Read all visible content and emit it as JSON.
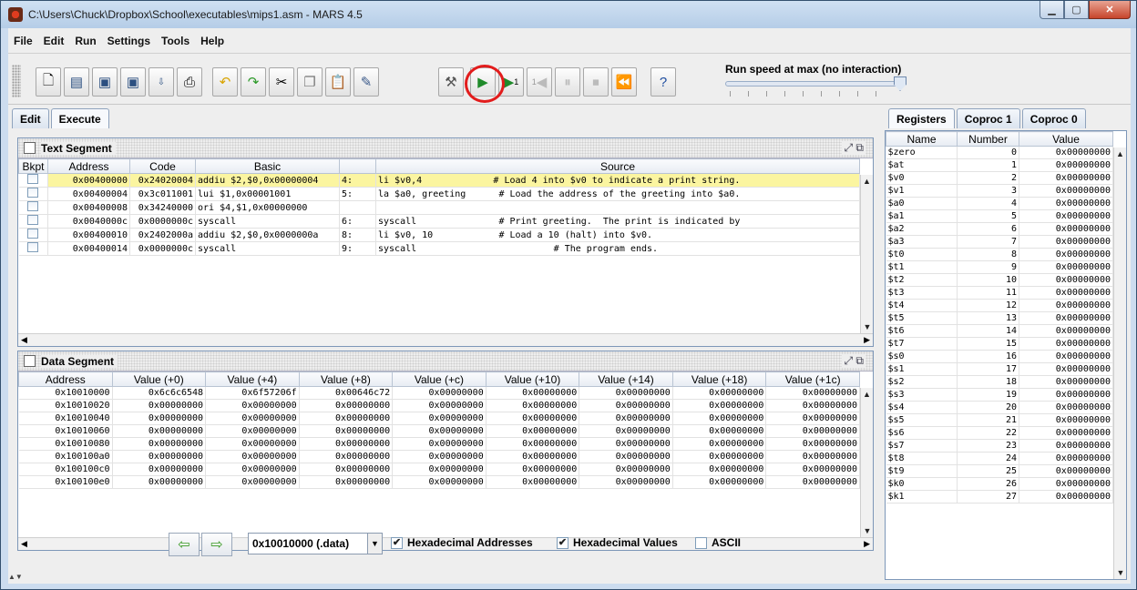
{
  "window": {
    "title": "C:\\Users\\Chuck\\Dropbox\\School\\executables\\mips1.asm  - MARS 4.5"
  },
  "menu": [
    "File",
    "Edit",
    "Run",
    "Settings",
    "Tools",
    "Help"
  ],
  "toolbar": {
    "buttons": [
      "new-icon",
      "open-icon",
      "save-icon",
      "save-as-icon",
      "dump-memory-icon",
      "print-icon",
      "undo-icon",
      "redo-icon",
      "cut-icon",
      "copy-icon",
      "paste-icon",
      "find-replace-icon",
      "assemble-icon",
      "run-icon",
      "step-icon",
      "backstep-icon",
      "pause-icon",
      "stop-icon",
      "reset-icon",
      "help-icon"
    ],
    "step_label": "1",
    "backstep_label": "1",
    "speed_label": "Run speed at max (no interaction)",
    "speed_level": 1.0
  },
  "tabs": {
    "edit": "Edit",
    "execute": "Execute"
  },
  "text_segment": {
    "title": "Text Segment",
    "columns": [
      "Bkpt",
      "Address",
      "Code",
      "Basic",
      "",
      "Source"
    ],
    "rows": [
      {
        "addr": "0x00400000",
        "code": "0x24020004",
        "basic": "addiu $2,$0,0x00000004",
        "line": "4:",
        "source": "li $v0,4             # Load 4 into $v0 to indicate a print string."
      },
      {
        "addr": "0x00400004",
        "code": "0x3c011001",
        "basic": "lui $1,0x00001001",
        "line": "5:",
        "source": "la $a0, greeting      # Load the address of the greeting into $a0."
      },
      {
        "addr": "0x00400008",
        "code": "0x34240000",
        "basic": "ori $4,$1,0x00000000",
        "line": "",
        "source": ""
      },
      {
        "addr": "0x0040000c",
        "code": "0x0000000c",
        "basic": "syscall",
        "line": "6:",
        "source": "syscall               # Print greeting.  The print is indicated by"
      },
      {
        "addr": "0x00400010",
        "code": "0x2402000a",
        "basic": "addiu $2,$0,0x0000000a",
        "line": "8:",
        "source": "li $v0, 10            # Load a 10 (halt) into $v0."
      },
      {
        "addr": "0x00400014",
        "code": "0x0000000c",
        "basic": "syscall",
        "line": "9:",
        "source": "syscall                         # The program ends."
      }
    ]
  },
  "data_segment": {
    "title": "Data Segment",
    "columns": [
      "Address",
      "Value (+0)",
      "Value (+4)",
      "Value (+8)",
      "Value (+c)",
      "Value (+10)",
      "Value (+14)",
      "Value (+18)",
      "Value (+1c)"
    ],
    "rows": [
      [
        "0x10010000",
        "0x6c6c6548",
        "0x6f57206f",
        "0x00646c72",
        "0x00000000",
        "0x00000000",
        "0x00000000",
        "0x00000000",
        "0x00000000"
      ],
      [
        "0x10010020",
        "0x00000000",
        "0x00000000",
        "0x00000000",
        "0x00000000",
        "0x00000000",
        "0x00000000",
        "0x00000000",
        "0x00000000"
      ],
      [
        "0x10010040",
        "0x00000000",
        "0x00000000",
        "0x00000000",
        "0x00000000",
        "0x00000000",
        "0x00000000",
        "0x00000000",
        "0x00000000"
      ],
      [
        "0x10010060",
        "0x00000000",
        "0x00000000",
        "0x00000000",
        "0x00000000",
        "0x00000000",
        "0x00000000",
        "0x00000000",
        "0x00000000"
      ],
      [
        "0x10010080",
        "0x00000000",
        "0x00000000",
        "0x00000000",
        "0x00000000",
        "0x00000000",
        "0x00000000",
        "0x00000000",
        "0x00000000"
      ],
      [
        "0x100100a0",
        "0x00000000",
        "0x00000000",
        "0x00000000",
        "0x00000000",
        "0x00000000",
        "0x00000000",
        "0x00000000",
        "0x00000000"
      ],
      [
        "0x100100c0",
        "0x00000000",
        "0x00000000",
        "0x00000000",
        "0x00000000",
        "0x00000000",
        "0x00000000",
        "0x00000000",
        "0x00000000"
      ],
      [
        "0x100100e0",
        "0x00000000",
        "0x00000000",
        "0x00000000",
        "0x00000000",
        "0x00000000",
        "0x00000000",
        "0x00000000",
        "0x00000000"
      ]
    ],
    "segment_select": "0x10010000 (.data)",
    "hex_addresses_label": "Hexadecimal Addresses",
    "hex_values_label": "Hexadecimal Values",
    "ascii_label": "ASCII"
  },
  "registers": {
    "tabs": [
      "Registers",
      "Coproc 1",
      "Coproc 0"
    ],
    "columns": [
      "Name",
      "Number",
      "Value"
    ],
    "rows": [
      [
        "$zero",
        "0",
        "0x00000000"
      ],
      [
        "$at",
        "1",
        "0x00000000"
      ],
      [
        "$v0",
        "2",
        "0x00000000"
      ],
      [
        "$v1",
        "3",
        "0x00000000"
      ],
      [
        "$a0",
        "4",
        "0x00000000"
      ],
      [
        "$a1",
        "5",
        "0x00000000"
      ],
      [
        "$a2",
        "6",
        "0x00000000"
      ],
      [
        "$a3",
        "7",
        "0x00000000"
      ],
      [
        "$t0",
        "8",
        "0x00000000"
      ],
      [
        "$t1",
        "9",
        "0x00000000"
      ],
      [
        "$t2",
        "10",
        "0x00000000"
      ],
      [
        "$t3",
        "11",
        "0x00000000"
      ],
      [
        "$t4",
        "12",
        "0x00000000"
      ],
      [
        "$t5",
        "13",
        "0x00000000"
      ],
      [
        "$t6",
        "14",
        "0x00000000"
      ],
      [
        "$t7",
        "15",
        "0x00000000"
      ],
      [
        "$s0",
        "16",
        "0x00000000"
      ],
      [
        "$s1",
        "17",
        "0x00000000"
      ],
      [
        "$s2",
        "18",
        "0x00000000"
      ],
      [
        "$s3",
        "19",
        "0x00000000"
      ],
      [
        "$s4",
        "20",
        "0x00000000"
      ],
      [
        "$s5",
        "21",
        "0x00000000"
      ],
      [
        "$s6",
        "22",
        "0x00000000"
      ],
      [
        "$s7",
        "23",
        "0x00000000"
      ],
      [
        "$t8",
        "24",
        "0x00000000"
      ],
      [
        "$t9",
        "25",
        "0x00000000"
      ],
      [
        "$k0",
        "26",
        "0x00000000"
      ],
      [
        "$k1",
        "27",
        "0x00000000"
      ]
    ]
  }
}
